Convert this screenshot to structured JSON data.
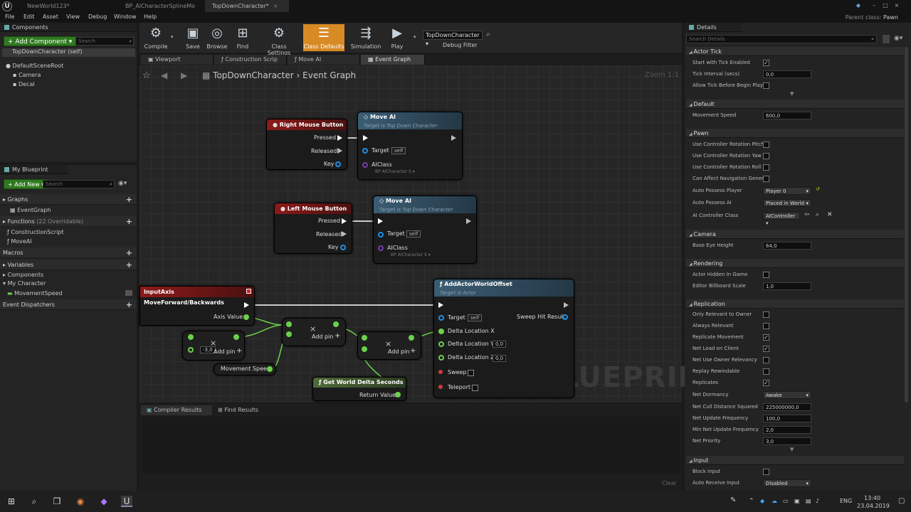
{
  "window": {
    "tabs": [
      "NewWorld123*",
      "BP_AICharacterSplineMo",
      "TopDownCharacter*"
    ],
    "parent_class_label": "Parent class:",
    "parent_class_value": "Pawn"
  },
  "menu": [
    "File",
    "Edit",
    "Asset",
    "View",
    "Debug",
    "Window",
    "Help"
  ],
  "components": {
    "title": "Components",
    "add_label": "+ Add Component ▾",
    "search_placeholder": "Search",
    "self_label": "TopDownCharacter (self)",
    "tree": [
      "DefaultSceneRoot",
      "Camera",
      "Decal"
    ]
  },
  "my_blueprint": {
    "title": "My Blueprint",
    "add_new_label": "+ Add New ▾",
    "search_placeholder": "Search",
    "graphs_label": "Graphs",
    "event_graph_label": "EventGraph",
    "functions_label": "Functions",
    "functions_count": "(22 Overridable)",
    "functions": [
      "ConstructionScript",
      "MoveAI"
    ],
    "macros_label": "Macros",
    "variables_label": "Variables",
    "components_label": "Components",
    "my_character_label": "My Character",
    "variable_item": "MovementSpeed",
    "event_dispatchers_label": "Event Dispatchers"
  },
  "toolbar": {
    "compile": "Compile",
    "save": "Save",
    "browse": "Browse",
    "find": "Find",
    "class_settings": "Class Settings",
    "class_defaults": "Class Defaults",
    "simulation": "Simulation",
    "play": "Play",
    "debug_object": "TopDownCharacter ▾",
    "debug_filter": "Debug Filter"
  },
  "editor_tabs": [
    "Viewport",
    "Construction Scrip",
    "Move AI",
    "Event Graph"
  ],
  "graph": {
    "breadcrumb_root": "TopDownCharacter",
    "breadcrumb_sep": "›",
    "breadcrumb_leaf": "Event Graph",
    "zoom": "Zoom 1:1",
    "watermark": "BLUEPRINT",
    "nodes": {
      "rmb": {
        "title": "Right Mouse Button",
        "pressed": "Pressed",
        "released": "Released",
        "key": "Key"
      },
      "lmb": {
        "title": "Left Mouse Button",
        "pressed": "Pressed",
        "released": "Released",
        "key": "Key"
      },
      "moveai1": {
        "title": "Move AI",
        "subtitle": "Target is Top Down Character",
        "target": "Target",
        "self": "self",
        "aiclass": "AIClass",
        "aiclass_val": "BP AICharacter S ▾"
      },
      "moveai2": {
        "title": "Move AI",
        "subtitle": "Target is Top Down Character",
        "target": "Target",
        "self": "self",
        "aiclass": "AIClass",
        "aiclass_val": "BP AICharacter S ▾"
      },
      "inputaxis": {
        "title": "InputAxis MoveForward/Backwards",
        "axis_value": "Axis Value"
      },
      "mult1": {
        "symbol": "×",
        "add_pin": "Add pin",
        "value": "-3,0"
      },
      "mult2": {
        "symbol": "×",
        "add_pin": "Add pin"
      },
      "mult3": {
        "symbol": "×",
        "add_pin": "Add pin"
      },
      "movement_speed": "Movement Speed",
      "world_delta": {
        "title": "Get World Delta Seconds",
        "return_value": "Return Value"
      },
      "add_offset": {
        "title": "AddActorWorldOffset",
        "subtitle": "Target is Actor",
        "target": "Target",
        "self": "self",
        "sweep_hit": "Sweep Hit Result",
        "dx": "Delta Location X",
        "dy": "Delta Location Y",
        "dy_val": "0,0",
        "dz": "Delta Location Z",
        "dz_val": "0,0",
        "sweep": "Sweep",
        "teleport": "Teleport"
      }
    }
  },
  "bottom": {
    "tabs": [
      "Compiler Results",
      "Find Results"
    ],
    "clear": "Clear"
  },
  "details": {
    "title": "Details",
    "search_placeholder": "Search Details",
    "sections": {
      "actor_tick": "Actor Tick",
      "default": "Default",
      "pawn": "Pawn",
      "camera": "Camera",
      "rendering": "Rendering",
      "replication": "Replication",
      "input": "Input"
    },
    "props": {
      "start_tick": "Start with Tick Enabled",
      "tick_interval": "Tick Interval (secs)",
      "tick_interval_val": "0,0",
      "allow_tick": "Allow Tick Before Begin Play",
      "movement_speed": "Movement Speed",
      "movement_speed_val": "600,0",
      "ucr_pitch": "Use Controller Rotation Pitch",
      "ucr_yaw": "Use Controller Rotation Yaw",
      "ucr_roll": "Use Controller Rotation Roll",
      "can_affect_nav": "Can Affect Navigation Gener",
      "auto_possess_player": "Auto Possess Player",
      "auto_possess_player_val": "Player 0",
      "auto_possess_ai": "Auto Possess AI",
      "auto_possess_ai_val": "Placed in World",
      "ai_controller": "AI Controller Class",
      "ai_controller_val": "AIController ▾",
      "base_eye": "Base Eye Height",
      "base_eye_val": "64,0",
      "actor_hidden": "Actor Hidden In Game",
      "billboard_scale": "Editor Billboard Scale",
      "billboard_scale_val": "1,0",
      "only_relevant": "Only Relevant to Owner",
      "always_relevant": "Always Relevant",
      "replicate_movement": "Replicate Movement",
      "net_load": "Net Load on Client",
      "net_use_owner": "Net Use Owner Relevancy",
      "replay_rewindable": "Replay Rewindable",
      "replicates": "Replicates",
      "net_dormancy": "Net Dormancy",
      "net_dormancy_val": "Awake",
      "net_cull": "Net Cull Distance Squared",
      "net_cull_val": "225000000,0",
      "net_update": "Net Update Frequency",
      "net_update_val": "100,0",
      "min_net_update": "Min Net Update Frequency",
      "min_net_update_val": "2,0",
      "net_priority": "Net Priority",
      "net_priority_val": "3,0",
      "block_input": "Block Input",
      "auto_receive": "Auto Receive Input",
      "auto_receive_val": "Disabled"
    }
  },
  "taskbar": {
    "lang": "ENG",
    "time": "13:40",
    "date": "23.04.2019"
  }
}
